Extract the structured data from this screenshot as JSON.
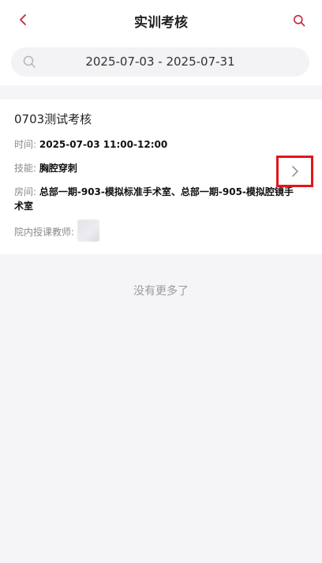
{
  "header": {
    "title": "实训考核",
    "back_icon": "chevron-left-icon",
    "search_icon": "search-icon",
    "accent_color": "#c2253f"
  },
  "date_filter": {
    "range": "2025-07-03 - 2025-07-31",
    "icon": "search-icon"
  },
  "card": {
    "name": "0703测试考核",
    "time_label": "时间:",
    "time_value": "2025-07-03 11:00-12:00",
    "skill_label": "技能:",
    "skill_value": "胸腔穿刺",
    "room_label": "房间:",
    "room_value": "总部一期-903-模拟标准手术室、总部一期-905-模拟腔镜手术室",
    "teacher_label": "院内授课教师:",
    "detail_icon": "chevron-right-icon"
  },
  "footer": {
    "no_more": "没有更多了"
  }
}
